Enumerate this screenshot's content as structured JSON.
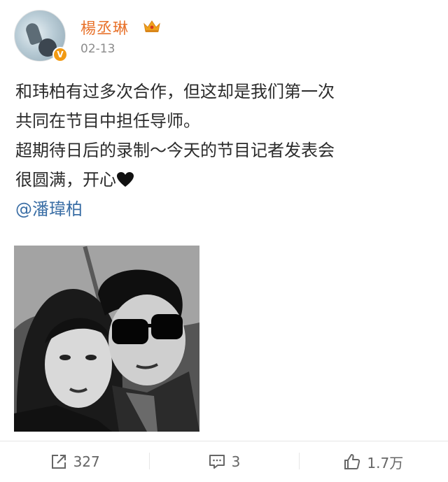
{
  "post": {
    "author": "楊丞琳",
    "time": "02-13",
    "verified_badge": "V",
    "lines": [
      "和玮柏有过多次合作，但这却是我们第一次",
      "共同在节目中担任导师。",
      "超期待日后的录制～今天的节目记者发表会",
      "很圆满，开心"
    ],
    "mention": "@潘瑋柏"
  },
  "footer": {
    "repost_count": "327",
    "comment_count": "3",
    "like_count": "1.7万"
  },
  "colors": {
    "username": "#e8732c",
    "mention": "#3a6ea5",
    "badge": "#f29a13"
  }
}
